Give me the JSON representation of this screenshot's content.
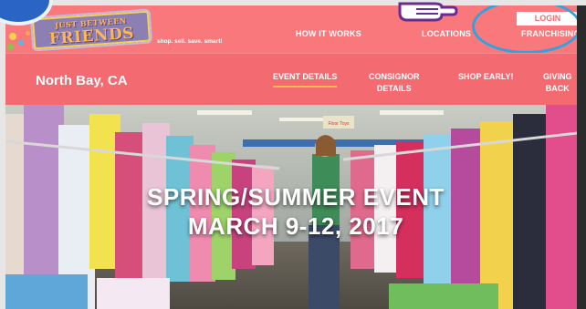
{
  "header": {
    "logo_line1": "JUST BETWEEN",
    "logo_line2": "FRIENDS",
    "tagline": "shop. sell. save. smart!",
    "nav": {
      "how_it_works": "HOW IT WORKS",
      "locations": "LOCATIONS",
      "franchising": "FRANCHISING",
      "login": "LOGIN"
    }
  },
  "subheader": {
    "city": "North Bay, CA",
    "nav": {
      "event_details": "EVENT DETAILS",
      "consignor_line1": "CONSIGNOR",
      "consignor_line2": "DETAILS",
      "shop_early": "SHOP EARLY!",
      "giving_line1": "GIVING",
      "giving_line2": "BACK"
    }
  },
  "hero": {
    "title_line1": "SPRING/SUMMER EVENT",
    "title_line2": "MARCH 9-12, 2017",
    "sign_text": "Floor Toys"
  },
  "colors": {
    "top_bar": "#f8787b",
    "sub_bar": "#f36b70",
    "annotation_blue": "#2aa4e2",
    "active_underline": "#f5b94a"
  },
  "icons": {
    "pointing_hand": "pointing-hand-icon",
    "circle_marker": "blue-circle-marker"
  }
}
